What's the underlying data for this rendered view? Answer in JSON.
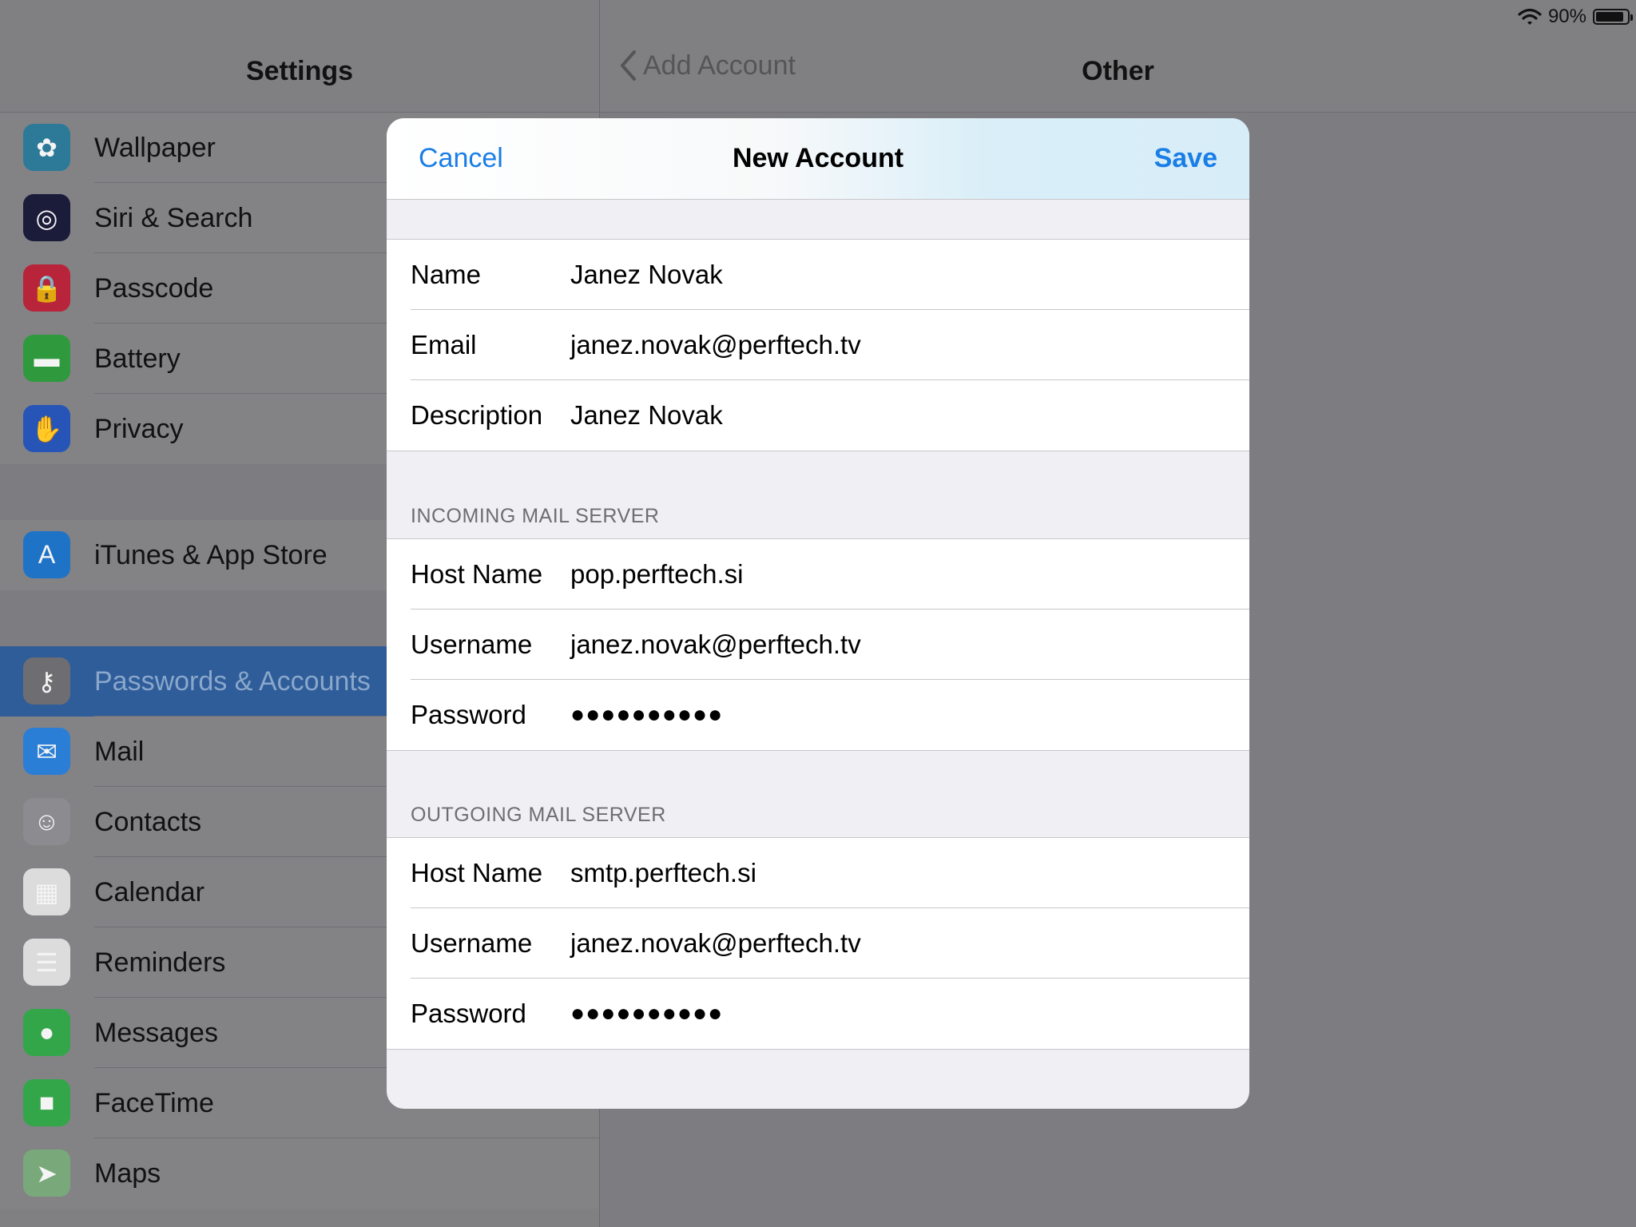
{
  "status_bar": {
    "battery_percent": "90%",
    "battery_level": 0.9
  },
  "sidebar": {
    "title": "Settings",
    "groups": [
      [
        {
          "label": "Wallpaper",
          "icon": "flower-icon",
          "color": "#2c7a97"
        },
        {
          "label": "Siri & Search",
          "icon": "siri-icon",
          "color": "#1b1b3a"
        },
        {
          "label": "Passcode",
          "icon": "lock-icon",
          "color": "#b8243a"
        },
        {
          "label": "Battery",
          "icon": "battery-icon",
          "color": "#2f9a3d"
        },
        {
          "label": "Privacy",
          "icon": "hand-icon",
          "color": "#2655b7"
        }
      ],
      [
        {
          "label": "iTunes & App Store",
          "icon": "app-store-icon",
          "color": "#1f73c7"
        }
      ],
      [
        {
          "label": "Passwords & Accounts",
          "icon": "key-icon",
          "color": "#6e6e72",
          "selected": true
        },
        {
          "label": "Mail",
          "icon": "envelope-icon",
          "color": "#2a7ed6"
        },
        {
          "label": "Contacts",
          "icon": "contacts-icon",
          "color": "#8c8c90"
        },
        {
          "label": "Calendar",
          "icon": "calendar-icon",
          "color": "#dcdcdc"
        },
        {
          "label": "Reminders",
          "icon": "reminders-icon",
          "color": "#dcdcdc"
        },
        {
          "label": "Messages",
          "icon": "speech-bubble-icon",
          "color": "#33a64a"
        },
        {
          "label": "FaceTime",
          "icon": "video-camera-icon",
          "color": "#33a64a"
        },
        {
          "label": "Maps",
          "icon": "map-icon",
          "color": "#79a97a"
        }
      ]
    ]
  },
  "detail": {
    "back_label": "Add Account",
    "title": "Other"
  },
  "modal": {
    "cancel_label": "Cancel",
    "title": "New Account",
    "save_label": "Save",
    "account": [
      {
        "label": "Name",
        "value": "Janez Novak"
      },
      {
        "label": "Email",
        "value": "janez.novak@perftech.tv"
      },
      {
        "label": "Description",
        "value": "Janez Novak"
      }
    ],
    "incoming": {
      "header": "INCOMING MAIL SERVER",
      "rows": [
        {
          "label": "Host Name",
          "value": "pop.perftech.si"
        },
        {
          "label": "Username",
          "value": "janez.novak@perftech.tv"
        },
        {
          "label": "Password",
          "value": "●●●●●●●●●●"
        }
      ]
    },
    "outgoing": {
      "header": "OUTGOING MAIL SERVER",
      "rows": [
        {
          "label": "Host Name",
          "value": "smtp.perftech.si"
        },
        {
          "label": "Username",
          "value": "janez.novak@perftech.tv"
        },
        {
          "label": "Password",
          "value": "●●●●●●●●●●"
        }
      ]
    }
  }
}
